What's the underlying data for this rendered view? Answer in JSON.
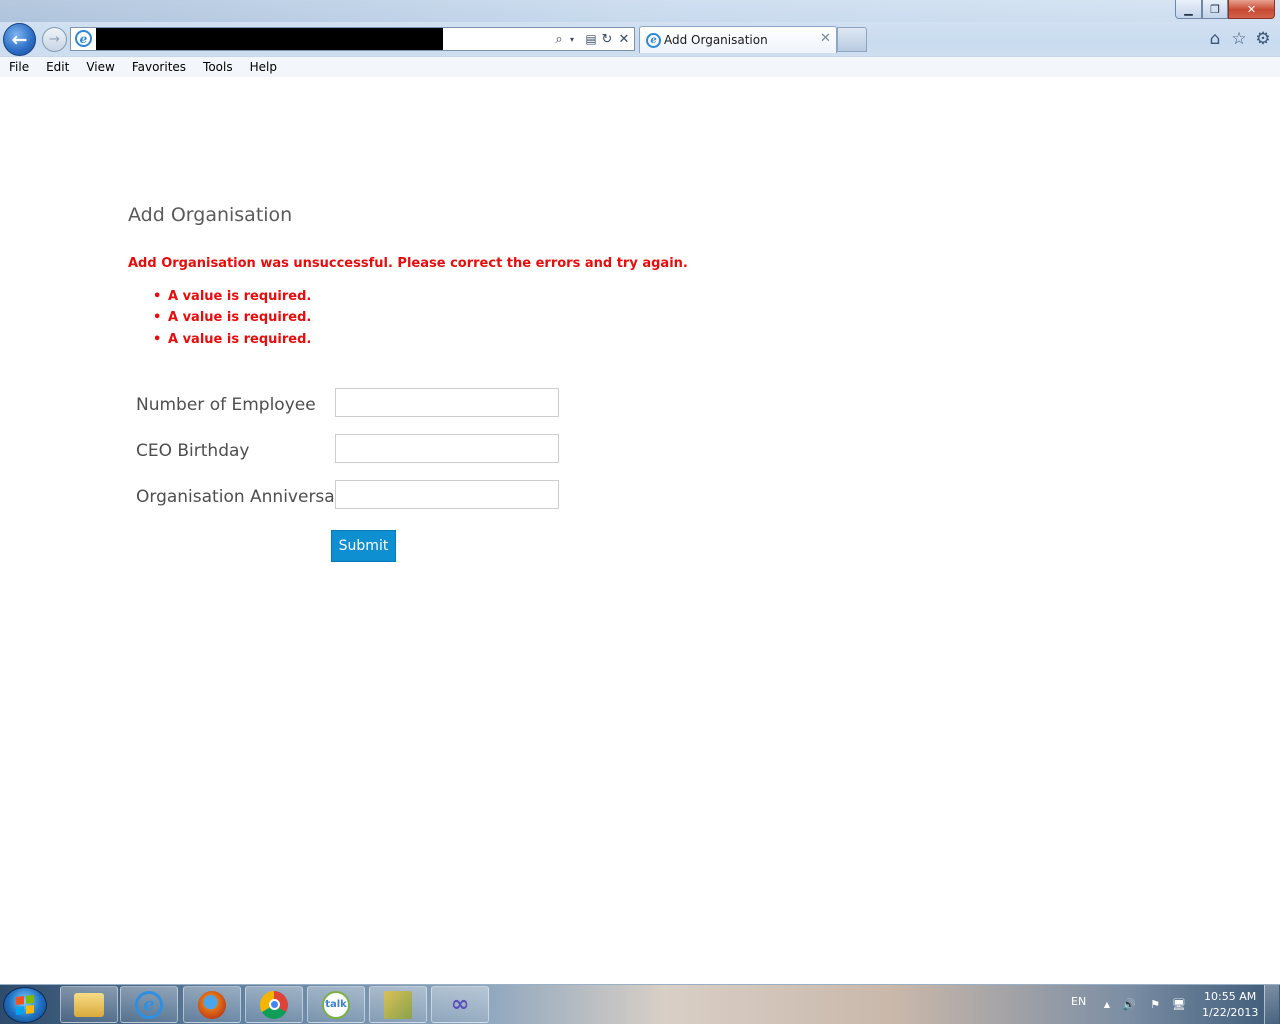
{
  "browser": {
    "window_buttons": {
      "minimize": "▁",
      "maximize": "❐",
      "close": "✕"
    },
    "nav": {
      "back": "←",
      "forward": "→"
    },
    "address": {
      "icons": {
        "search": "⌕",
        "dropdown": "▾",
        "compat": "▤",
        "refresh": "↻",
        "stop": "✕"
      }
    },
    "tab": {
      "title": "Add Organisation",
      "close": "✕"
    },
    "toolbar_icons": {
      "home": "⌂",
      "favorites": "☆",
      "tools": "⚙"
    },
    "menu": [
      "File",
      "Edit",
      "View",
      "Favorites",
      "Tools",
      "Help"
    ]
  },
  "page": {
    "title": "Add Organisation",
    "error_summary": "Add Organisation was unsuccessful. Please correct the errors and try again.",
    "errors": [
      "A value is required.",
      "A value is required.",
      "A value is required."
    ],
    "fields": [
      {
        "label": "Number of Employee",
        "value": ""
      },
      {
        "label": "CEO Birthday",
        "value": ""
      },
      {
        "label": "Organisation Anniversary",
        "value": ""
      }
    ],
    "submit_label": "Submit",
    "colors": {
      "error": "#e80c0c",
      "button": "#0d8fd1",
      "label": "#4e4e4e"
    }
  },
  "taskbar": {
    "apps": [
      "explorer-icon",
      "ie-icon",
      "firefox-icon",
      "chrome-icon",
      "google-talk-icon",
      "tools-icon",
      "visual-studio-icon"
    ],
    "talk_label": "talk",
    "tray": {
      "language": "EN",
      "arrow": "▲",
      "volume": "🔊",
      "flag": "⚑",
      "network": "🖥"
    },
    "clock": {
      "time": "10:55 AM",
      "date": "1/22/2013"
    }
  }
}
